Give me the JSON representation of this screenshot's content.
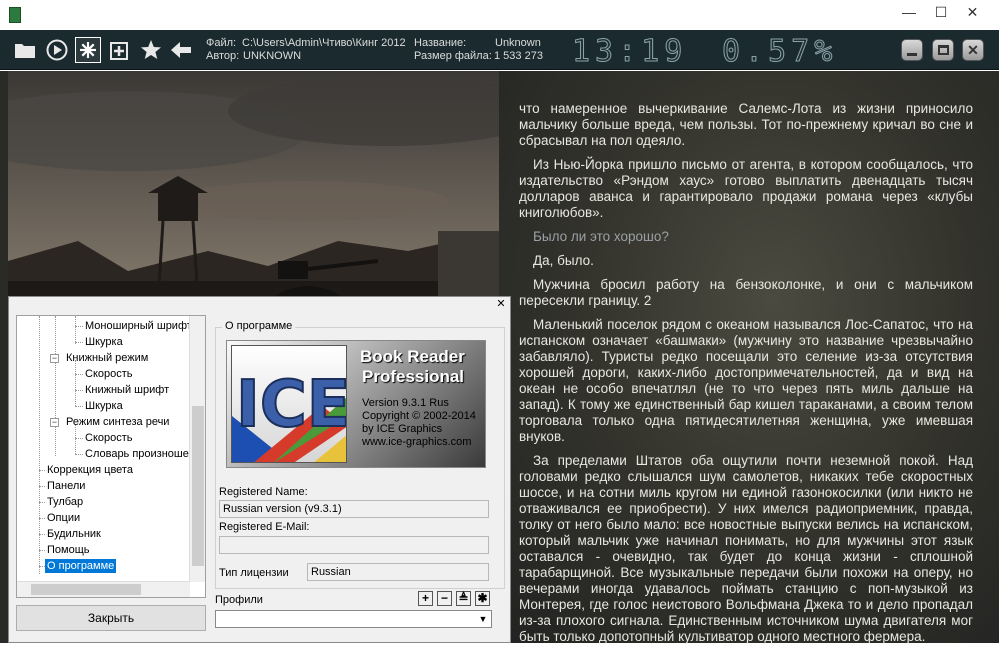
{
  "window": {
    "minimize_symbol": "—",
    "maximize_symbol": "☐",
    "close_symbol": "✕"
  },
  "toolbar": {
    "icons": [
      "folder-icon",
      "play-icon",
      "settings-icon",
      "add-bookmark-icon",
      "star-icon",
      "back-arrow-icon"
    ],
    "file_label": "Файл:",
    "file_value": "C:\\Users\\Admin\\Чтиво\\Кинг 2012",
    "author_label": "Автор:",
    "author_value": "UNKNOWN",
    "title_label": "Название:",
    "title_value": "Unknown",
    "size_label": "Размер файла:",
    "size_value": "1 533 273",
    "clock": "13:19",
    "progress": "0.57%",
    "accent_color": "#1a2a2e"
  },
  "book": {
    "paragraphs": [
      {
        "text": "что намеренное вычеркивание Салемс-Лота из жизни приносило мальчику больше вреда, чем пользы. Тот по-прежнему кричал во сне и сбрасывал на пол одеяло.",
        "dim": false,
        "indent": false
      },
      {
        "text": "Из Нью-Йорка пришло письмо от агента, в котором сообщалось, что издательство «Рэндом хаус» готово выплатить двенадцать тысяч долларов аванса и гарантировало продажи романа через «клубы книголюбов».",
        "dim": false,
        "indent": true
      },
      {
        "text": "Было ли это хорошо?",
        "dim": true,
        "indent": true
      },
      {
        "text": "Да, было.",
        "dim": false,
        "indent": true
      },
      {
        "text": "Мужчина бросил работу на бензоколонке, и они с мальчиком пересекли границу. 2",
        "dim": false,
        "indent": true
      },
      {
        "text": "Маленький поселок рядом с океаном назывался Лос-Сапатос, что на испанском означает «башмаки» (мужчину это название чрезвычайно забавляло). Туристы редко посещали это селение из-за отсутствия хорошей дороги, каких-либо достопримечательностей, да и вид на океан не особо впечатлял (не то что через пять миль дальше на запад). К тому же единственный бар кишел тараканами, а своим телом торговала только одна пятидесятилетняя женщина, уже имевшая внуков.",
        "dim": false,
        "indent": true
      },
      {
        "text": "За пределами Штатов оба ощутили почти неземной покой. Над головами редко слышался шум самолетов, никаких тебе скоростных шоссе, и на сотни миль кругом ни единой газонокосилки (или никто не отваживался ее приобрести). У них имелся радиоприемник, правда, толку от него было мало: все новостные выпуски велись на испанском, который мальчик уже начинал понимать, но для мужчины этот язык оставался - очевидно, так будет до конца жизни - сплошной тарабарщиной. Все музыкальные передачи были похожи на оперу, но вечерами иногда удавалось поймать станцию с поп-музыкой из Монтерея, где голос неистового Вольфмана Джека то и дело пропадал из-за плохого сигнала. Единственным источником шума двигателя мог быть только допотопный культиватор одного местного фермера.",
        "dim": false,
        "indent": true
      }
    ]
  },
  "dialog": {
    "close_symbol": "✕",
    "tree": [
      {
        "label": "Моноширный шрифт",
        "level": 3,
        "selected": false
      },
      {
        "label": "Шкурка",
        "level": 3,
        "selected": false
      },
      {
        "label": "Книжный режим",
        "level": 2,
        "selected": false,
        "expander": "−"
      },
      {
        "label": "Скорость",
        "level": 3,
        "selected": false
      },
      {
        "label": "Книжный шрифт",
        "level": 3,
        "selected": false
      },
      {
        "label": "Шкурка",
        "level": 3,
        "selected": false
      },
      {
        "label": "Режим синтеза речи",
        "level": 2,
        "selected": false,
        "expander": "−"
      },
      {
        "label": "Скорость",
        "level": 3,
        "selected": false
      },
      {
        "label": "Словарь произношени",
        "level": 3,
        "selected": false
      },
      {
        "label": "Коррекция цвета",
        "level": 1,
        "selected": false
      },
      {
        "label": "Панели",
        "level": 1,
        "selected": false
      },
      {
        "label": "Тулбар",
        "level": 1,
        "selected": false
      },
      {
        "label": "Опции",
        "level": 1,
        "selected": false
      },
      {
        "label": "Будильник",
        "level": 1,
        "selected": false
      },
      {
        "label": "Помощь",
        "level": 1,
        "selected": false
      },
      {
        "label": "О программе",
        "level": 1,
        "selected": true
      }
    ],
    "close_button": "Закрыть",
    "about_legend": "О программе",
    "logo": {
      "ice": "ICE",
      "line1": "Book Reader",
      "line2": "Professional",
      "version": "Version 9.3.1 Rus",
      "copyright": "Copyright © 2002-2014",
      "company": "by ICE Graphics",
      "site": "www.ice-graphics.com"
    },
    "registered_name_label": "Registered Name:",
    "registered_name_value": "Russian version (v9.3.1)",
    "registered_email_label": "Registered E-Mail:",
    "registered_email_value": "",
    "license_label": "Тип лицензии",
    "license_value": "Russian",
    "profiles_label": "Профили",
    "profile_buttons": [
      "+",
      "−",
      "≜",
      "✱"
    ],
    "profile_selected": ""
  }
}
